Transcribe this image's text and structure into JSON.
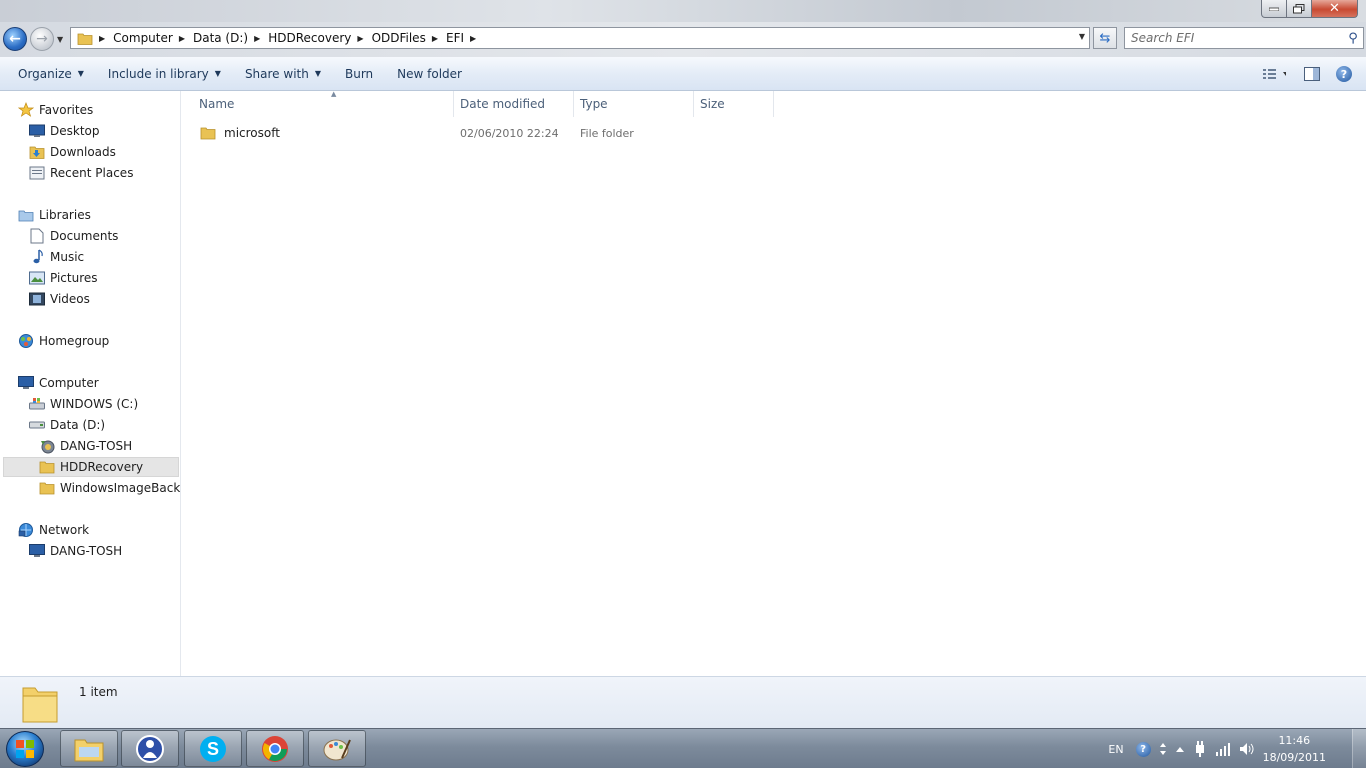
{
  "window": {
    "nav": {
      "back_label": "Back",
      "forward_label": "Forward"
    },
    "breadcrumb": [
      "Computer",
      "Data (D:)",
      "HDDRecovery",
      "ODDFiles",
      "EFI"
    ],
    "search": {
      "placeholder": "Search EFI"
    }
  },
  "toolbar": {
    "organize": "Organize",
    "include_in_library": "Include in library",
    "share_with": "Share with",
    "burn": "Burn",
    "new_folder": "New folder"
  },
  "nav_pane": {
    "favorites": {
      "label": "Favorites",
      "items": [
        "Desktop",
        "Downloads",
        "Recent Places"
      ]
    },
    "libraries": {
      "label": "Libraries",
      "items": [
        "Documents",
        "Music",
        "Pictures",
        "Videos"
      ]
    },
    "homegroup": {
      "label": "Homegroup"
    },
    "computer": {
      "label": "Computer",
      "drives": [
        "WINDOWS (C:)",
        "Data (D:)"
      ],
      "data_children": [
        "DANG-TOSH",
        "HDDRecovery",
        "WindowsImageBackup"
      ],
      "selected": "HDDRecovery"
    },
    "network": {
      "label": "Network",
      "items": [
        "DANG-TOSH"
      ]
    }
  },
  "file_list": {
    "columns": [
      "Name",
      "Date modified",
      "Type",
      "Size"
    ],
    "rows": [
      {
        "name": "microsoft",
        "date_modified": "02/06/2010 22:24",
        "type": "File folder",
        "size": ""
      }
    ]
  },
  "details_pane": {
    "count": "1 item"
  },
  "taskbar": {
    "language": "EN",
    "time": "11:46",
    "date": "18/09/2011"
  },
  "colors": {
    "accent": "#2a6cc4",
    "command_text": "#1e395b",
    "folder_yellow": "#f3d06a"
  }
}
